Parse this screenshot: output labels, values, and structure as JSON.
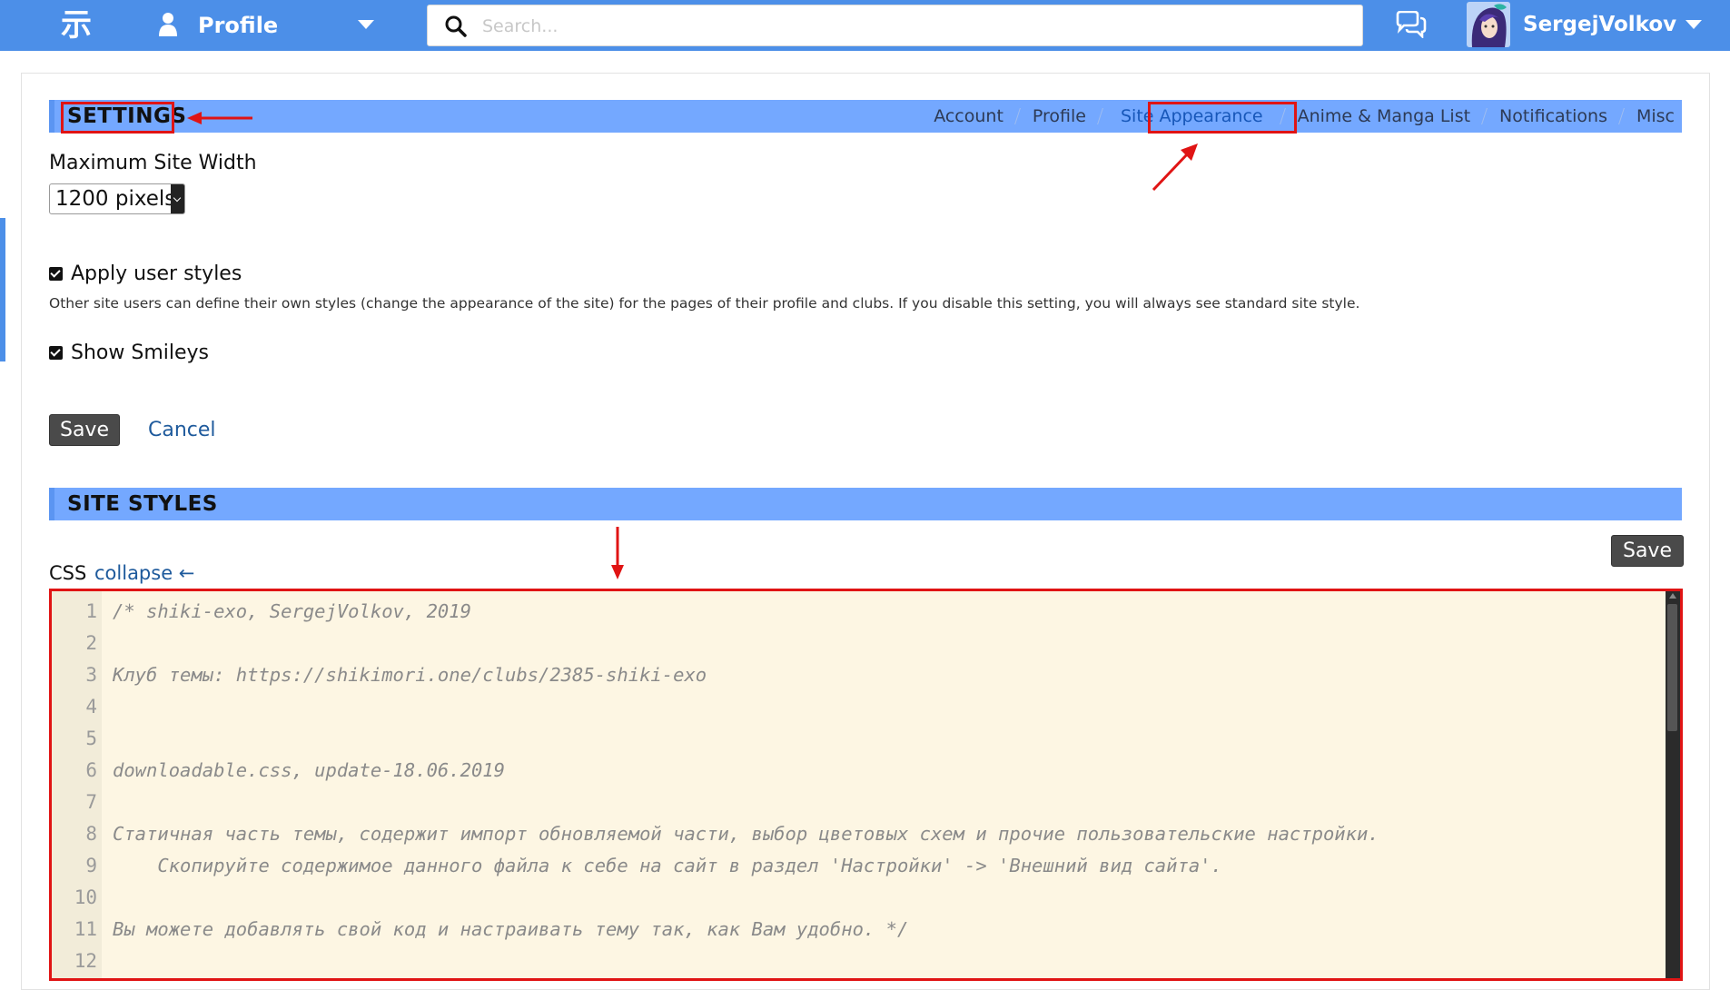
{
  "topbar": {
    "logo": "示",
    "profile_label": "Profile",
    "search_placeholder": "Search...",
    "username": "SergejVolkov"
  },
  "settings": {
    "title": "SETTINGS",
    "tabs": [
      {
        "label": "Account",
        "active": false
      },
      {
        "label": "Profile",
        "active": false
      },
      {
        "label": "Site Appearance",
        "active": true
      },
      {
        "label": "Anime & Manga List",
        "active": false
      },
      {
        "label": "Notifications",
        "active": false
      },
      {
        "label": "Misc",
        "active": false
      }
    ],
    "max_width_label": "Maximum Site Width",
    "max_width_value": "1200 pixels",
    "apply_styles_label": "Apply user styles",
    "apply_styles_hint": "Other site users can define their own styles (change the appearance of the site) for the pages of their profile and clubs. If you disable this setting, you will always see standard site style.",
    "show_smileys_label": "Show Smileys",
    "save_label": "Save",
    "cancel_label": "Cancel"
  },
  "site_styles": {
    "title": "SITE STYLES",
    "css_label": "CSS",
    "collapse_label": "collapse ←",
    "save_label": "Save",
    "code_lines": [
      {
        "no": "1",
        "text": "/* shiki-exo, SergejVolkov, 2019"
      },
      {
        "no": "2",
        "text": ""
      },
      {
        "no": "3",
        "text": "Клуб темы: https://shikimori.one/clubs/2385-shiki-exo"
      },
      {
        "no": "4",
        "text": ""
      },
      {
        "no": "5",
        "text": ""
      },
      {
        "no": "6",
        "text": "downloadable.css, update-18.06.2019"
      },
      {
        "no": "7",
        "text": ""
      },
      {
        "no": "8",
        "text": "Статичная часть темы, содержит импорт обновляемой части, выбор цветовых схем и прочие пользовательские настройки."
      },
      {
        "no": "9",
        "text": "    Скопируйте содержимое данного файла к себе на сайт в раздел 'Настройки' -> 'Внешний вид сайта'."
      },
      {
        "no": "10",
        "text": ""
      },
      {
        "no": "11",
        "text": "Вы можете добавлять свой код и настраивать тему так, как Вам удобно. */"
      },
      {
        "no": "12",
        "text": ""
      }
    ]
  },
  "colors": {
    "topbar": "#4c8fe8",
    "section_bar": "#74a8ff",
    "annotation_red": "#e01414",
    "editor_bg": "#fdf6e3"
  }
}
